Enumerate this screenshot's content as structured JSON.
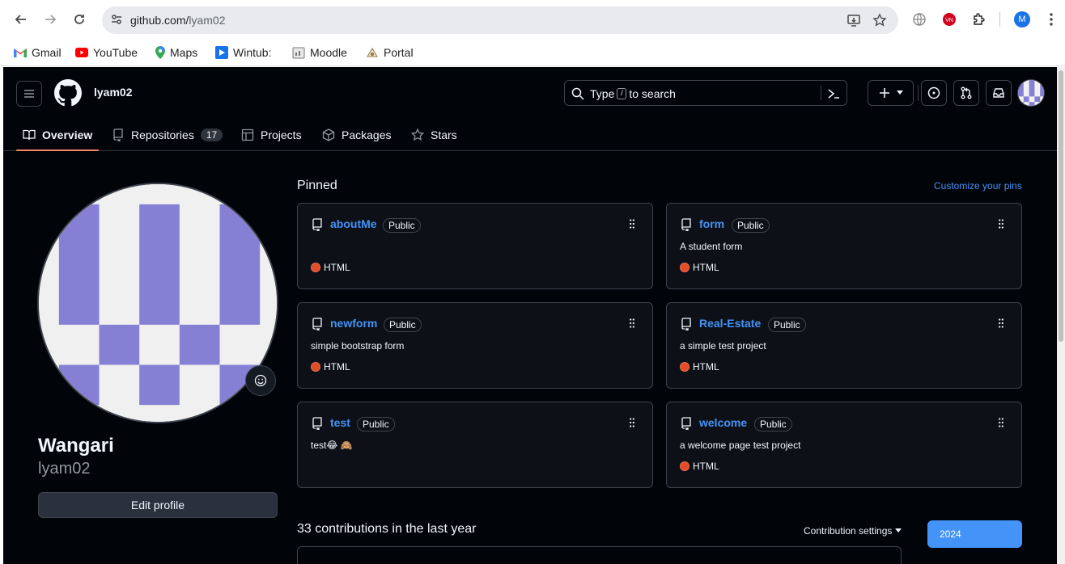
{
  "browser": {
    "url_host": "github.com/",
    "url_path": "lyam02",
    "profile_initial": "M",
    "bookmarks": [
      {
        "label": "Gmail",
        "icon": "gmail-icon"
      },
      {
        "label": "YouTube",
        "icon": "youtube-icon"
      },
      {
        "label": "Maps",
        "icon": "maps-icon"
      },
      {
        "label": "Wintub:",
        "icon": "wintub-icon"
      },
      {
        "label": "Moodle",
        "icon": "moodle-icon"
      },
      {
        "label": "Portal",
        "icon": "portal-icon"
      }
    ]
  },
  "header": {
    "username": "lyam02",
    "search_prefix": "Type",
    "search_key": "/",
    "search_suffix": "to search"
  },
  "tabs": [
    {
      "label": "Overview",
      "icon": "book-icon",
      "active": true
    },
    {
      "label": "Repositories",
      "icon": "repo-icon",
      "count": "17"
    },
    {
      "label": "Projects",
      "icon": "table-icon"
    },
    {
      "label": "Packages",
      "icon": "package-icon"
    },
    {
      "label": "Stars",
      "icon": "star-icon"
    }
  ],
  "profile": {
    "name": "Wangari",
    "login": "lyam02",
    "edit_label": "Edit profile",
    "avatar_color": "#8680d4"
  },
  "pinned": {
    "title": "Pinned",
    "customize_label": "Customize your pins",
    "repos": [
      {
        "name": "aboutMe",
        "visibility": "Public",
        "description": "",
        "language": "HTML"
      },
      {
        "name": "form",
        "visibility": "Public",
        "description": "A student form",
        "language": "HTML"
      },
      {
        "name": "newform",
        "visibility": "Public",
        "description": "simple bootstrap form",
        "language": "HTML"
      },
      {
        "name": "Real-Estate",
        "visibility": "Public",
        "description": "a simple test project",
        "language": "HTML"
      },
      {
        "name": "test",
        "visibility": "Public",
        "description": "test😂 🙈",
        "language": ""
      },
      {
        "name": "welcome",
        "visibility": "Public",
        "description": "a welcome page test project",
        "language": "HTML"
      }
    ]
  },
  "contributions": {
    "title": "33 contributions in the last year",
    "settings_label": "Contribution settings",
    "year": "2024"
  },
  "colors": {
    "accent": "#4493f8",
    "tab_underline": "#f78166",
    "html_lang": "#e34c26",
    "background": "#010409"
  }
}
